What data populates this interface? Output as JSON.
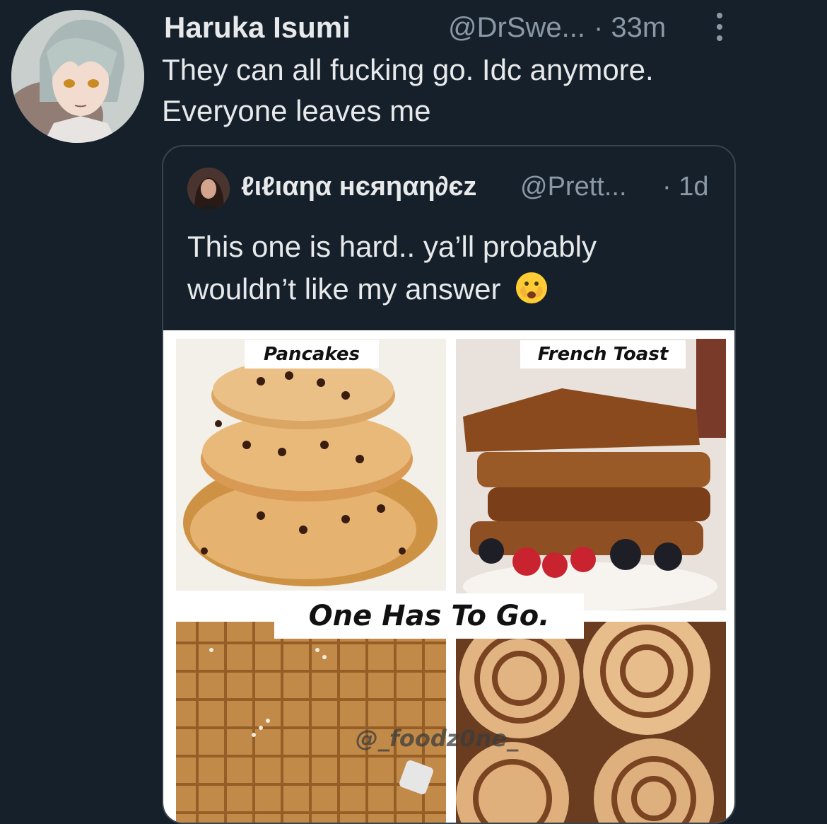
{
  "tweet": {
    "author_name": "Haruka Isumi",
    "author_handle": "@DrSwe...",
    "time": "· 33m",
    "text_line1": "They can all fucking go. Idc anymore.",
    "text_line2": "Everyone leaves me",
    "avatar_icon": "anime-avatar-icon",
    "more_icon": "more-vertical-icon"
  },
  "quote": {
    "author_name": "ℓιℓιαηα нєяηαη∂єz",
    "author_handle": "@Prett...",
    "time": "· 1d",
    "text_line1": "This one is hard.. ya’ll probably",
    "text_line2": "wouldn’t like my answer",
    "emoji": "face-with-open-eyes-and-hand-over-mouth-icon",
    "media": {
      "label_top_left": "Pancakes",
      "label_top_right": "French Toast",
      "label_center": "One Has To Go.",
      "watermark": "@_foodz0ne_"
    }
  },
  "colors": {
    "background": "#15202b",
    "text_primary": "#e7e9ea",
    "text_secondary": "#8b98a5",
    "border": "#38444d"
  }
}
